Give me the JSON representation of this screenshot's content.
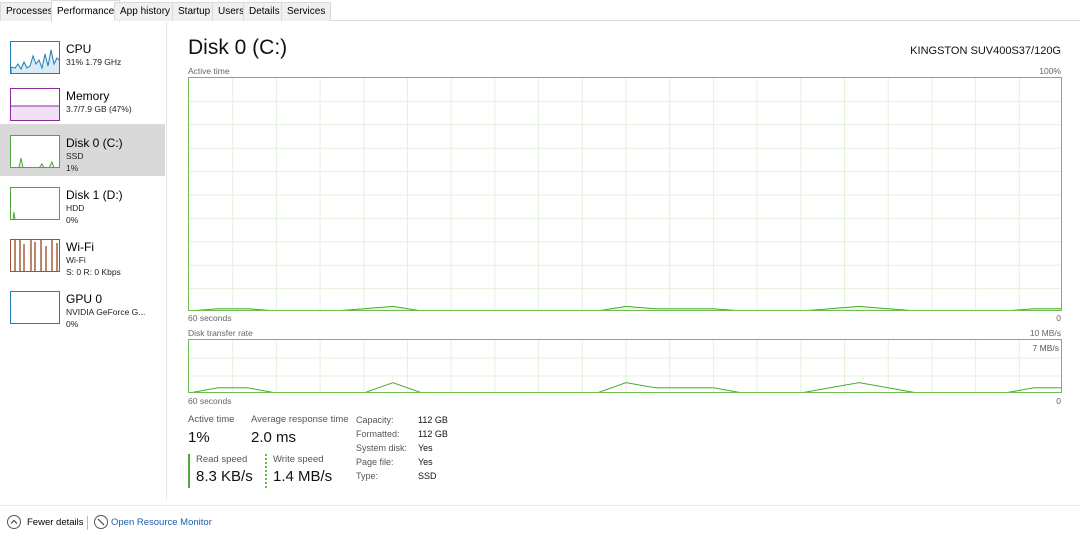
{
  "tabs": [
    "Processes",
    "Performance",
    "App history",
    "Startup",
    "Users",
    "Details",
    "Services"
  ],
  "active_tab": "Performance",
  "sidebar": {
    "items": [
      {
        "title": "CPU",
        "line1": "31% 1.79 GHz",
        "line2": "",
        "color": "#1e7fb8",
        "icon": "cpu-graph"
      },
      {
        "title": "Memory",
        "line1": "3.7/7.9 GB (47%)",
        "line2": "",
        "color": "#8b2c9a",
        "icon": "memory-graph"
      },
      {
        "title": "Disk 0 (C:)",
        "line1": "SSD",
        "line2": "1%",
        "color": "#4fa63b",
        "icon": "disk-graph"
      },
      {
        "title": "Disk 1 (D:)",
        "line1": "HDD",
        "line2": "0%",
        "color": "#4fa63b",
        "icon": "disk-graph"
      },
      {
        "title": "Wi-Fi",
        "line1": "Wi-Fi",
        "line2": "S: 0 R: 0 Kbps",
        "color": "#a0522d",
        "icon": "network-graph"
      },
      {
        "title": "GPU 0",
        "line1": "NVIDIA GeForce G...",
        "line2": "0%",
        "color": "#1e7fb8",
        "icon": "gpu-graph"
      }
    ]
  },
  "main": {
    "title": "Disk 0 (C:)",
    "model": "KINGSTON SUV400S37/120G",
    "chart1": {
      "label": "Active time",
      "max_label": "100%",
      "time_label": "60 seconds",
      "min_label": "0"
    },
    "chart2": {
      "label": "Disk transfer rate",
      "max_label": "10 MB/s",
      "mid_label": "7 MB/s",
      "time_label": "60 seconds",
      "min_label": "0"
    },
    "stats": {
      "active_time_label": "Active time",
      "active_time_value": "1%",
      "avg_response_label": "Average response time",
      "avg_response_value": "2.0 ms",
      "read_label": "Read speed",
      "read_value": "8.3 KB/s",
      "write_label": "Write speed",
      "write_value": "1.4 MB/s"
    },
    "properties": [
      {
        "key": "Capacity:",
        "value": "112 GB"
      },
      {
        "key": "Formatted:",
        "value": "112 GB"
      },
      {
        "key": "System disk:",
        "value": "Yes"
      },
      {
        "key": "Page file:",
        "value": "Yes"
      },
      {
        "key": "Type:",
        "value": "SSD"
      }
    ]
  },
  "footer": {
    "fewer_details": "Fewer details",
    "open_resource_monitor": "Open Resource Monitor"
  },
  "chart_data": [
    {
      "type": "area",
      "title": "Active time",
      "xlabel": "60 seconds",
      "ylim": [
        0,
        100
      ],
      "x": [
        0,
        2,
        4,
        6,
        8,
        10,
        12,
        14,
        16,
        18,
        20,
        22,
        24,
        26,
        28,
        30,
        32,
        34,
        36,
        38,
        40,
        42,
        44,
        46,
        48,
        50,
        52,
        54,
        56,
        58,
        60
      ],
      "series": [
        {
          "values": [
            0,
            1,
            1,
            0,
            0,
            0,
            1,
            2,
            0,
            0,
            0,
            0,
            0,
            0,
            0,
            2,
            1,
            1,
            1,
            0,
            0,
            0,
            1,
            2,
            1,
            0,
            0,
            0,
            0,
            1,
            1
          ]
        }
      ]
    },
    {
      "type": "line",
      "title": "Disk transfer rate",
      "xlabel": "60 seconds",
      "ylim": [
        0,
        10
      ],
      "x": [
        0,
        2,
        4,
        6,
        8,
        10,
        12,
        14,
        16,
        18,
        20,
        22,
        24,
        26,
        28,
        30,
        32,
        34,
        36,
        38,
        40,
        42,
        44,
        46,
        48,
        50,
        52,
        54,
        56,
        58,
        60
      ],
      "series": [
        {
          "values": [
            0,
            1,
            1,
            0,
            0,
            0,
            0,
            2,
            0,
            0,
            0,
            0,
            0,
            0,
            0,
            2,
            1,
            1,
            1,
            0,
            0,
            0,
            1,
            2,
            1,
            0,
            0,
            0,
            0,
            1,
            1
          ]
        },
        {
          "values": [
            0,
            0,
            0,
            0,
            0,
            0,
            0,
            0,
            0,
            0,
            0,
            0,
            0,
            0,
            0,
            0,
            0,
            0,
            0,
            0,
            0,
            0,
            0,
            0,
            0,
            0,
            0,
            0,
            0,
            0,
            0
          ]
        }
      ]
    }
  ],
  "colors": {
    "disk_line": "#4fa63b",
    "disk_fill": "#e9f5e3",
    "grid": "#e4f2dd",
    "link": "#1a5fb4"
  }
}
